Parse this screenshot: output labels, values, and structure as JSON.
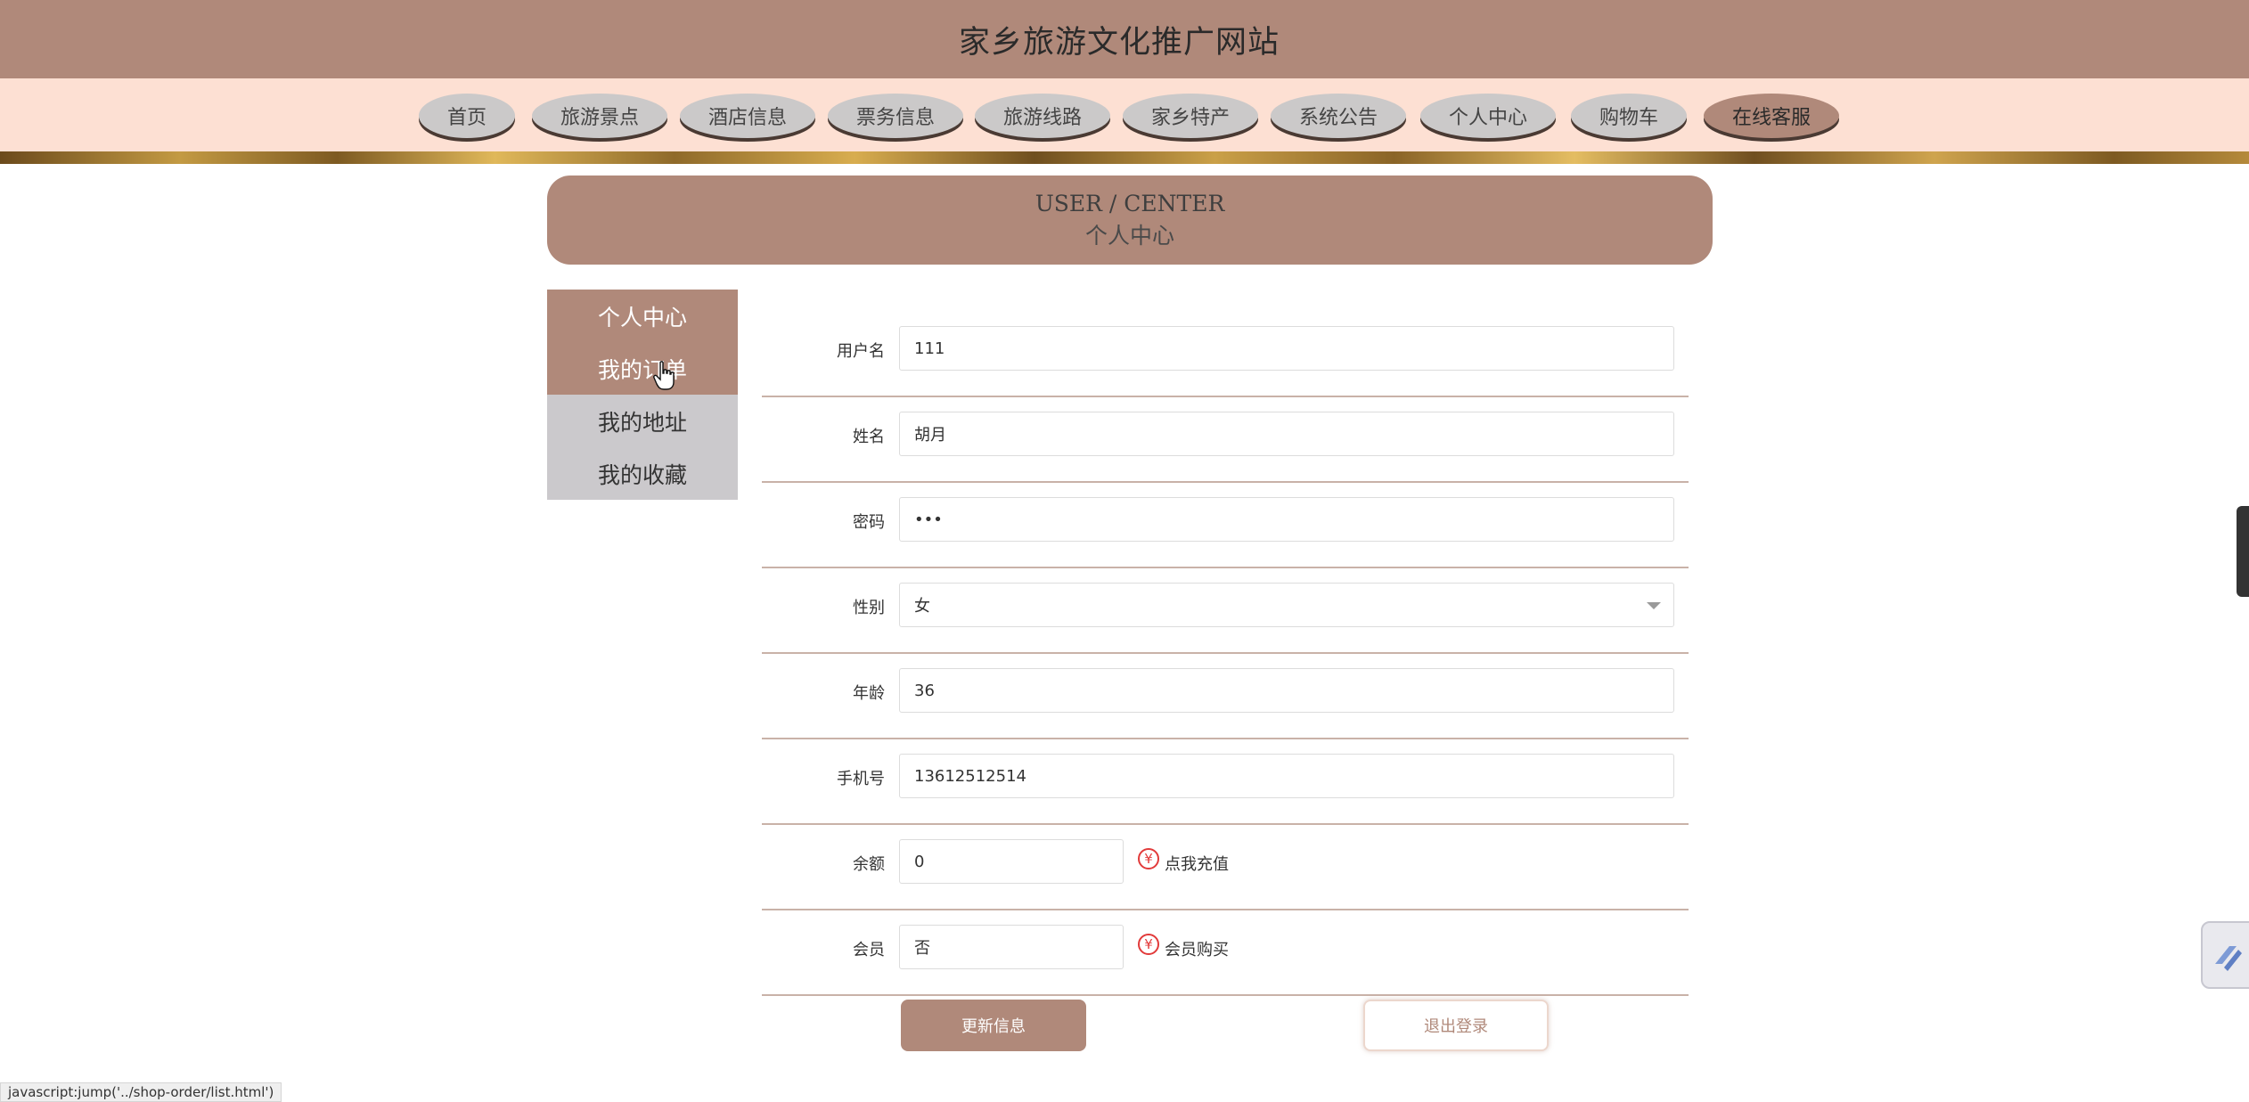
{
  "site": {
    "title": "家乡旅游文化推广网站"
  },
  "nav": {
    "items": [
      {
        "label": "首页"
      },
      {
        "label": "旅游景点"
      },
      {
        "label": "酒店信息"
      },
      {
        "label": "票务信息"
      },
      {
        "label": "旅游线路"
      },
      {
        "label": "家乡特产"
      },
      {
        "label": "系统公告"
      },
      {
        "label": "个人中心"
      },
      {
        "label": "购物车"
      },
      {
        "label": "在线客服"
      }
    ],
    "active_index": 9
  },
  "header": {
    "en": "USER / CENTER",
    "cn": "个人中心"
  },
  "sidebar": {
    "items": [
      {
        "label": "个人中心",
        "state": "active"
      },
      {
        "label": "我的订单",
        "state": "active"
      },
      {
        "label": "我的地址",
        "state": "normal"
      },
      {
        "label": "我的收藏",
        "state": "normal"
      }
    ]
  },
  "form": {
    "username": {
      "label": "用户名",
      "value": "111"
    },
    "name": {
      "label": "姓名",
      "value": "胡月"
    },
    "password": {
      "label": "密码",
      "value": "•••"
    },
    "gender": {
      "label": "性别",
      "value": "女"
    },
    "age": {
      "label": "年龄",
      "value": "36"
    },
    "phone": {
      "label": "手机号",
      "value": "13612512514"
    },
    "balance": {
      "label": "余额",
      "value": "0",
      "action": "点我充值"
    },
    "member": {
      "label": "会员",
      "value": "否",
      "action": "会员购买"
    }
  },
  "buttons": {
    "update": "更新信息",
    "logout": "退出登录"
  },
  "status": {
    "url": "javascript:jump('../shop-order/list.html')"
  },
  "icons": {
    "yen": "¥"
  },
  "colors": {
    "primary": "#b0897a",
    "nav_bg": "#fde0d3",
    "inactive_pill": "#cbc9c9",
    "yen_red": "#e23a3a"
  }
}
